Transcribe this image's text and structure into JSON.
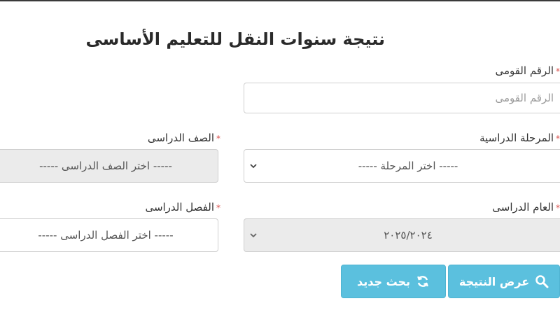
{
  "page": {
    "title": "نتيجة سنوات النقل للتعليم الأساسى"
  },
  "form": {
    "national_id": {
      "label": "الرقم القومى",
      "placeholder": "الرقم القومى"
    },
    "stage": {
      "label": "المرحلة الدراسية",
      "value": "----- اختر المرحلة -----"
    },
    "grade": {
      "label": "الصف الدراسى",
      "value": "----- اختر الصف الدراسى -----"
    },
    "year": {
      "label": "العام الدراسى",
      "value": "٢٠٢٥/٢٠٢٤"
    },
    "term": {
      "label": "الفصل الدراسى",
      "value": "----- اختر الفصل الدراسى -----"
    },
    "required_mark": "*"
  },
  "actions": {
    "show_result": {
      "label": "عرض النتيجة",
      "icon": "search-icon"
    },
    "new_search": {
      "label": "بحث جديد",
      "icon": "refresh-icon"
    }
  },
  "colors": {
    "button": "#5bc0de",
    "required": "#d9534f",
    "disabled_field": "#ebebeb"
  }
}
